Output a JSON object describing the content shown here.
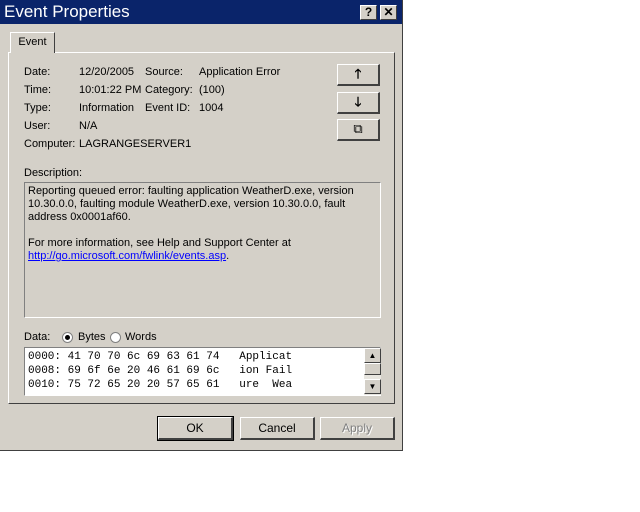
{
  "window": {
    "title": "Event Properties",
    "help_btn": "?",
    "close_btn": "✕"
  },
  "tabs": {
    "event": "Event"
  },
  "fields": {
    "date_label": "Date:",
    "date_value": "12/20/2005",
    "source_label": "Source:",
    "source_value": "Application Error",
    "time_label": "Time:",
    "time_value": "10:01:22 PM",
    "category_label": "Category:",
    "category_value": "(100)",
    "type_label": "Type:",
    "type_value": "Information",
    "eventid_label": "Event ID:",
    "eventid_value": "1004",
    "user_label": "User:",
    "user_value": "N/A",
    "computer_label": "Computer:",
    "computer_value": "LAGRANGESERVER1"
  },
  "nav": {
    "up": "🡑",
    "down": "🡓",
    "copy": "⧉"
  },
  "description": {
    "label": "Description:",
    "text": "Reporting queued error: faulting application WeatherD.exe, version 10.30.0.0, faulting module WeatherD.exe, version 10.30.0.0, fault address 0x0001af60.",
    "info": "For more information, see Help and Support Center at",
    "link": "http://go.microsoft.com/fwlink/events.asp",
    "link_suffix": "."
  },
  "data_section": {
    "label": "Data:",
    "bytes_label": "Bytes",
    "words_label": "Words",
    "selected": "Bytes",
    "rows": [
      "0000: 41 70 70 6c 69 63 61 74   Applicat",
      "0008: 69 6f 6e 20 46 61 69 6c   ion Fail",
      "0010: 75 72 65 20 20 57 65 61   ure  Wea"
    ]
  },
  "buttons": {
    "ok": "OK",
    "cancel": "Cancel",
    "apply": "Apply"
  },
  "colors": {
    "titlebar": "#0a246a",
    "face": "#d4d0c8",
    "link": "#0000ff"
  }
}
